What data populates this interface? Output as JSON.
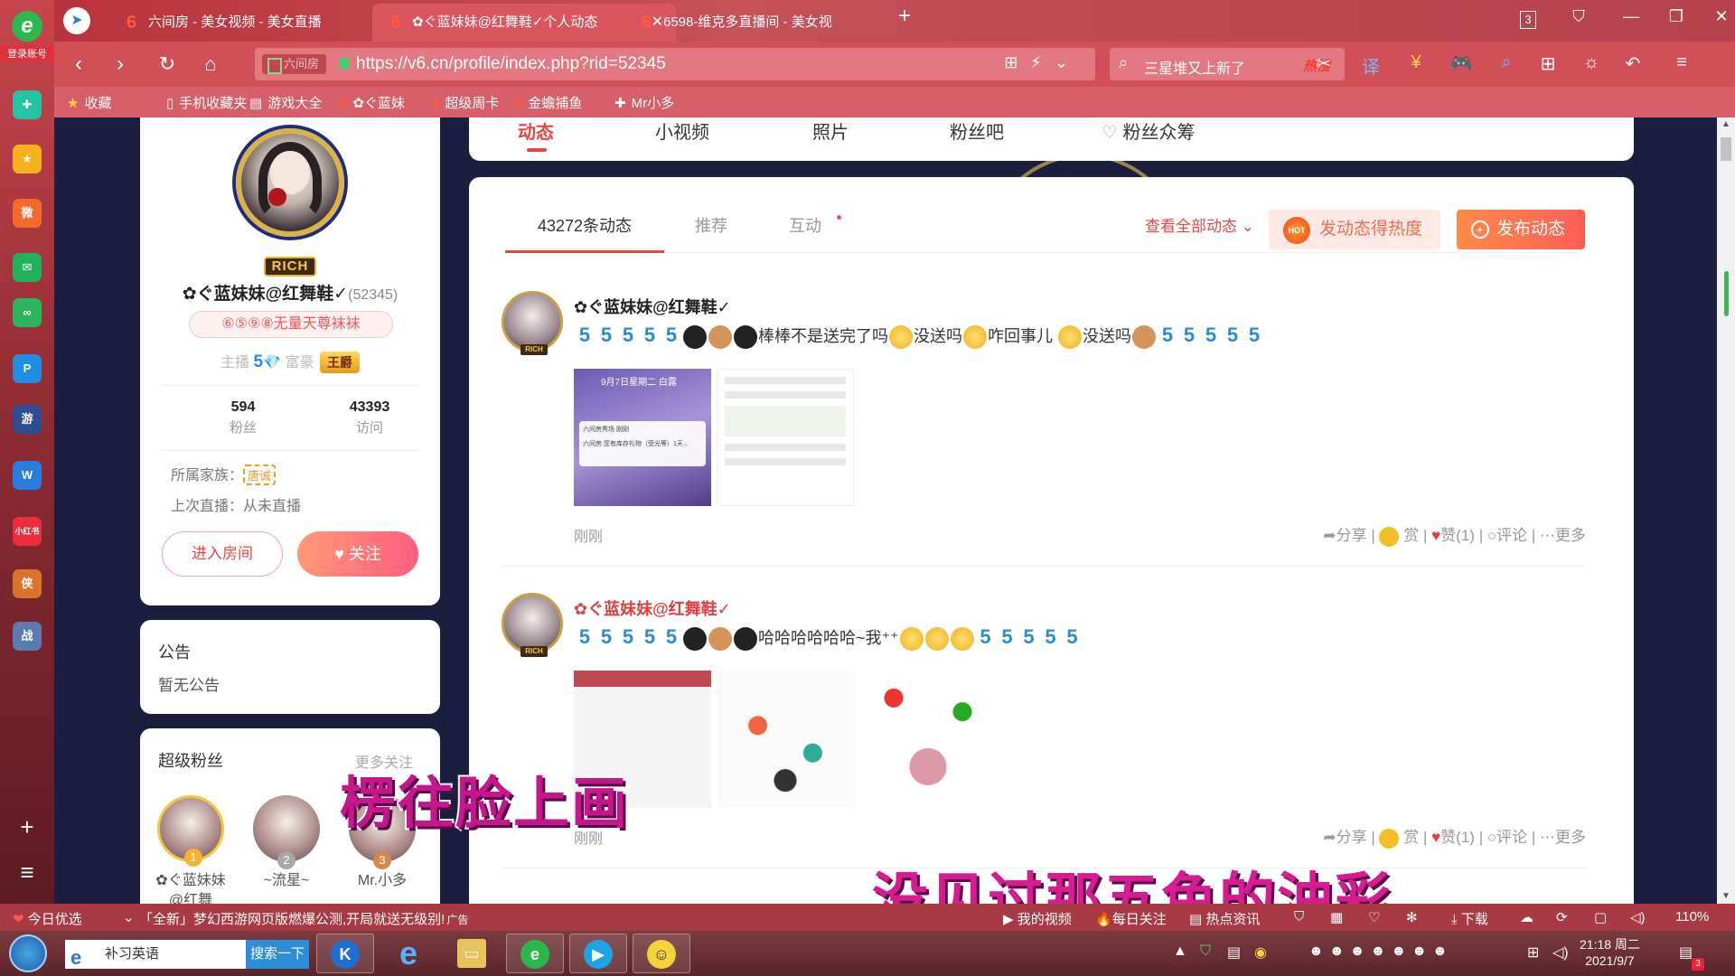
{
  "leftbar": {
    "login_label": "登录账号",
    "apps": [
      {
        "name": "app-refresh",
        "glyph": "✚",
        "color": "#23c4a2"
      },
      {
        "name": "app-favorites",
        "glyph": "★",
        "color": "#f6b21a"
      },
      {
        "name": "app-weibo",
        "glyph": "微",
        "color": "#f36b2c"
      },
      {
        "name": "app-mail",
        "glyph": "✉",
        "color": "#22b05a"
      },
      {
        "name": "app-cloud",
        "glyph": "∞",
        "color": "#2cb55c"
      },
      {
        "name": "app-p",
        "glyph": "P",
        "color": "#1f8ee0"
      },
      {
        "name": "app-game",
        "glyph": "游",
        "color": "#2c4d8f"
      },
      {
        "name": "app-doc",
        "glyph": "W",
        "color": "#2a7de0"
      },
      {
        "name": "app-xiaohongshu",
        "glyph": "小红书",
        "color": "#ee2c3a"
      },
      {
        "name": "app-game2",
        "glyph": "侠",
        "color": "#d9742a"
      },
      {
        "name": "app-game3",
        "glyph": "战",
        "color": "#5a7bb0"
      }
    ]
  },
  "tabs": [
    {
      "label": "六间房 - 美女视频 - 美女直播"
    },
    {
      "label": "✿ぐ蓝妹妹@红舞鞋✓个人动态"
    },
    {
      "label": "6598-维克多直播间 - 美女视"
    }
  ],
  "window_controls": {
    "tab_count": "3"
  },
  "address": {
    "site_label": "六间房",
    "url": "https://v6.cn/profile/index.php?rid=52345"
  },
  "search": {
    "text": "三星堆又上新了",
    "hot_label": "热搜"
  },
  "bookmarks": [
    {
      "label": "收藏",
      "icon": "★"
    },
    {
      "label": "手机收藏夹",
      "icon": "▯"
    },
    {
      "label": "游戏大全",
      "icon": "▤"
    },
    {
      "label": "✿ぐ蓝妹",
      "icon": "6"
    },
    {
      "label": "超级周卡",
      "icon": "6"
    },
    {
      "label": "金蟾捕鱼",
      "icon": "6"
    },
    {
      "label": "Mr小多",
      "icon": "✚"
    }
  ],
  "nav": {
    "tabs": [
      {
        "label": "动态"
      },
      {
        "label": "小视频"
      },
      {
        "label": "照片"
      },
      {
        "label": "粉丝吧"
      },
      {
        "label": "粉丝众筹"
      }
    ]
  },
  "profile": {
    "rich_badge": "RICH",
    "name": "✿ぐ蓝妹妹@红舞鞋✓",
    "rid": "(52345)",
    "motto": "⑥⑤⑨⑧无量天尊袜袜",
    "anchor_label": "主播",
    "anchor_level": "5",
    "rich_label": "富豪",
    "rich_title": "王爵",
    "fans_count": "594",
    "fans_label": "粉丝",
    "visits_count": "43393",
    "visits_label": "访问",
    "family_label": "所属家族：",
    "family_value": "唐诚",
    "last_live": "上次直播：从未直播",
    "enter_room": "进入房间",
    "follow": "关注"
  },
  "notice": {
    "title": "公告",
    "content": "暂无公告"
  },
  "superfans": {
    "title": "超级粉丝",
    "more": "更多关注",
    "fans": [
      {
        "rank": "1",
        "name": "✿ぐ蓝妹妹@红舞",
        "color": "#f2b431"
      },
      {
        "rank": "2",
        "name": "~流星~",
        "color": "#a8a8a8"
      },
      {
        "rank": "3",
        "name": "Mr.小多",
        "color": "#d9884a"
      }
    ]
  },
  "feed": {
    "subtabs": [
      {
        "label": "43272条动态"
      },
      {
        "label": "推荐"
      },
      {
        "label": "互动"
      }
    ],
    "see_all": "查看全部动态",
    "hot_button": "发动态得热度",
    "hot_icon_text": "HOT",
    "post_button": "发布动态",
    "posts": [
      {
        "author": "✿ぐ蓝妹妹@红舞鞋✓",
        "text_a": "棒棒不是送完了吗",
        "text_b": "没送吗",
        "text_c": "咋回事儿",
        "text_d": "没送吗",
        "time": "刚刚",
        "share": "分享",
        "reward": "赏",
        "like": "赞(1)",
        "comment": "评论",
        "more": "更多"
      },
      {
        "author": "✿ぐ蓝妹妹@红舞鞋✓",
        "text_a": "哈哈哈哈哈哈~我⁺⁺",
        "time": "刚刚",
        "share": "分享",
        "reward": "赏",
        "like": "赞(1)",
        "comment": "评论",
        "more": "更多"
      }
    ],
    "thumb_texts": {
      "date": "9月7日星期二 白露",
      "app": "六间房秀场 刚刚",
      "line": "六间房 您有库存礼物（受光等）1天..."
    }
  },
  "captions": {
    "line1": "楞往脸上画",
    "line2": "没见过那五色的油彩"
  },
  "statusbar": {
    "today": "今日优选",
    "news": "「全新」梦幻西游网页版燃爆公测,开局就送无级别!",
    "ad": "广告",
    "my_video": "我的视频",
    "daily": "每日关注",
    "hot_news": "热点资讯",
    "download": "下载",
    "zoom": "110%"
  },
  "taskbar": {
    "search_text": "补习英语",
    "search_button": "搜索一下",
    "time": "21:18 周二",
    "date": "2021/9/7",
    "notif": "3"
  }
}
